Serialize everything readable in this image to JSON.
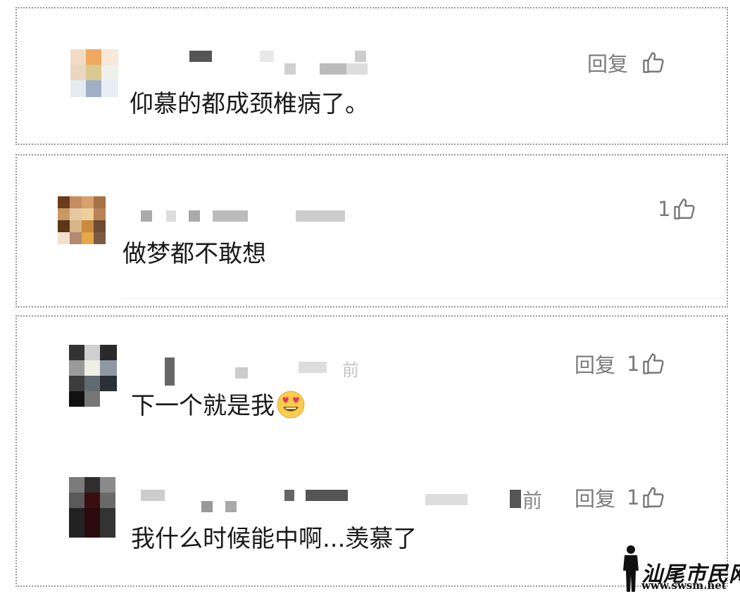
{
  "comments": [
    {
      "text": "仰慕的都成颈椎病了。",
      "reply_label": "回复",
      "like_count": ""
    },
    {
      "text": "做梦都不敢想",
      "reply_label": "",
      "like_count": "1"
    },
    {
      "text": "下一个就是我",
      "reply_label": "回复",
      "like_count": "1",
      "time_fragment": "前",
      "emoji": "heart-eyes-emoji",
      "time_hint": "前"
    },
    {
      "text": "我什么时候能中啊...羡慕了",
      "reply_label": "回复",
      "like_count": "1",
      "time_fragment": "前"
    }
  ],
  "watermark": {
    "name": "汕尾市民网",
    "url": "www.swsm.net"
  },
  "colors": {
    "text": "#1a1a1a",
    "meta": "#7a7a7a",
    "border": "#9a9a9a"
  }
}
